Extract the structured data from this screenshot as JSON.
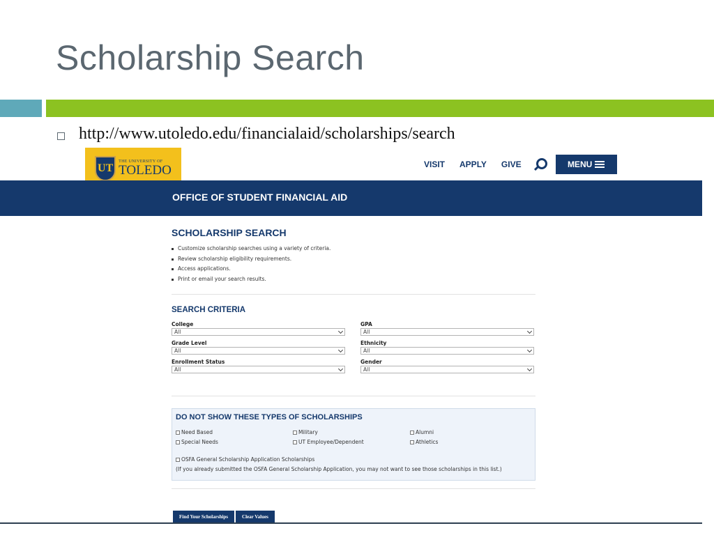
{
  "slide": {
    "title": "Scholarship Search",
    "url": "http://www.utoledo.edu/financialaid/scholarships/search"
  },
  "colors": {
    "brand_blue": "#15396c",
    "accent_green": "#8cc221",
    "accent_teal": "#5fa9b9",
    "logo_gold": "#f3c01c"
  },
  "site": {
    "logo": {
      "shield_text": "UT",
      "small_text": "THE UNIVERSITY OF",
      "big_text": "TOLEDO"
    },
    "nav": {
      "visit": "VISIT",
      "apply": "APPLY",
      "give": "GIVE",
      "menu": "MENU"
    },
    "office_title": "OFFICE OF STUDENT FINANCIAL AID"
  },
  "page": {
    "heading": "SCHOLARSHIP SEARCH",
    "intro_items": [
      "Customize scholarship searches using a variety of criteria.",
      "Review scholarship eligibility requirements.",
      "Access applications.",
      "Print or email your search results."
    ],
    "criteria_heading": "SEARCH CRITERIA",
    "fields": {
      "college": {
        "label": "College",
        "value": "All"
      },
      "gpa": {
        "label": "GPA",
        "value": "All"
      },
      "grade_level": {
        "label": "Grade Level",
        "value": "All"
      },
      "ethnicity": {
        "label": "Ethnicity",
        "value": "All"
      },
      "enrollment_status": {
        "label": "Enrollment Status",
        "value": "All"
      },
      "gender": {
        "label": "Gender",
        "value": "All"
      }
    },
    "exclude_heading": "DO NOT SHOW THESE TYPES OF SCHOLARSHIPS",
    "exclude_options": [
      "Need Based",
      "Military",
      "Alumni",
      "Special Needs",
      "UT Employee/Dependent",
      "Athletics"
    ],
    "osfa_label": "OSFA General Scholarship Application Scholarships",
    "osfa_note": "(If you already submitted the OSFA General Scholarship Application, you may not want to see those scholarships in this list.)",
    "buttons": {
      "find": "Find Your Scholarships",
      "clear": "Clear Values"
    }
  }
}
